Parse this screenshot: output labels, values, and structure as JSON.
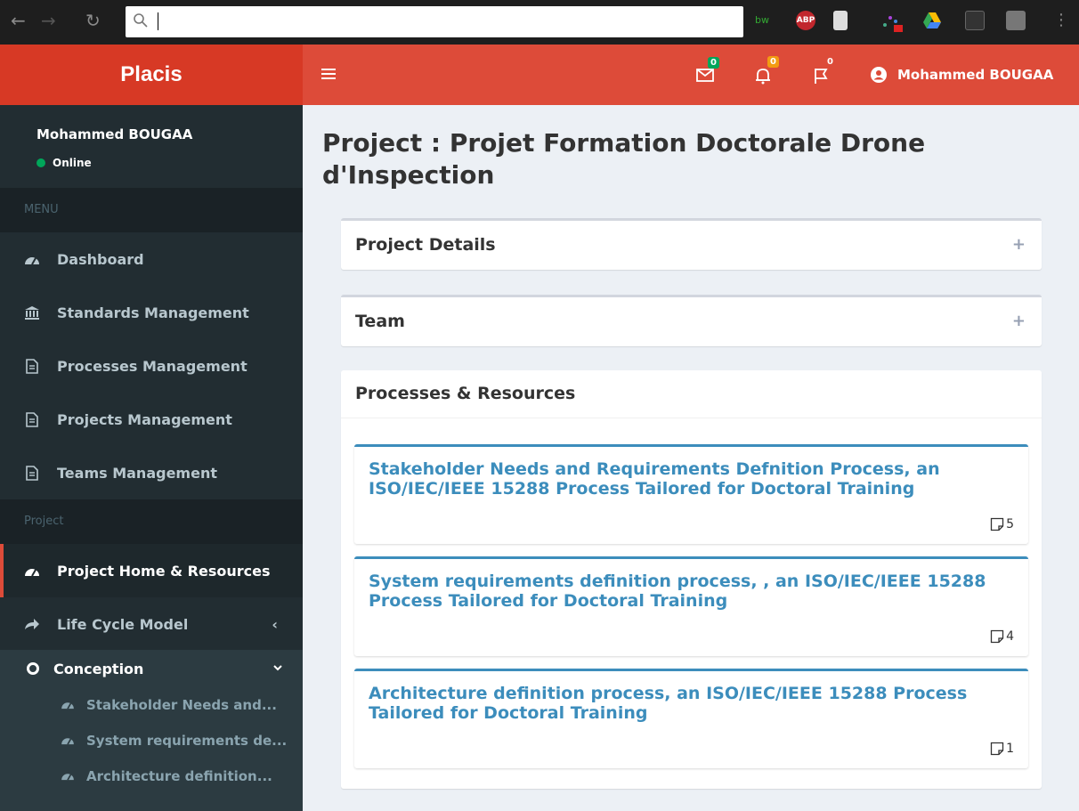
{
  "header": {
    "logo": "Placis",
    "mail_badge": "0",
    "notif_badge": "0",
    "flag_badge": "0",
    "user_name": "Mohammed BOUGAA"
  },
  "sidebar": {
    "user_name": "Mohammed BOUGAA",
    "status": "Online",
    "menu_header": "MENU",
    "items": [
      {
        "label": "Dashboard",
        "icon": "dashboard-icon"
      },
      {
        "label": "Standards Management",
        "icon": "bank-icon"
      },
      {
        "label": "Processes Management",
        "icon": "file-icon"
      },
      {
        "label": "Projects Management",
        "icon": "file-icon"
      },
      {
        "label": "Teams Management",
        "icon": "file-icon"
      }
    ],
    "project_header": "Project",
    "project_items": [
      {
        "label": "Project Home & Resources",
        "icon": "dashboard-icon"
      },
      {
        "label": "Life Cycle Model",
        "icon": "share-arrow-icon"
      }
    ],
    "conception": {
      "label": "Conception",
      "items": [
        {
          "label": "Stakeholder Needs and..."
        },
        {
          "label": "System requirements de..."
        },
        {
          "label": "Architecture definition..."
        }
      ]
    }
  },
  "main": {
    "page_title": "Project : Projet Formation Doctorale Drone d'Inspection",
    "boxes": [
      {
        "title": "Project Details",
        "tool": "+"
      },
      {
        "title": "Team",
        "tool": "+"
      }
    ],
    "processes_box": {
      "title": "Processes & Resources",
      "processes": [
        {
          "name": "Stakeholder Needs and Requirements Defnition Process, an ISO/IEC/IEEE 15288 Process Tailored for Doctoral Training",
          "count": "5"
        },
        {
          "name": "System requirements definition process, , an ISO/IEC/IEEE 15288 Process Tailored for Doctoral Training",
          "count": "4"
        },
        {
          "name": "Architecture definition process, an ISO/IEC/IEEE 15288 Process Tailored for Doctoral Training",
          "count": "1"
        }
      ]
    }
  },
  "colors": {
    "header": "#dd4b39",
    "logo_bg": "#d73925",
    "sidebar": "#222d32",
    "link": "#3c8dbc",
    "content_bg": "#ecf0f5"
  }
}
